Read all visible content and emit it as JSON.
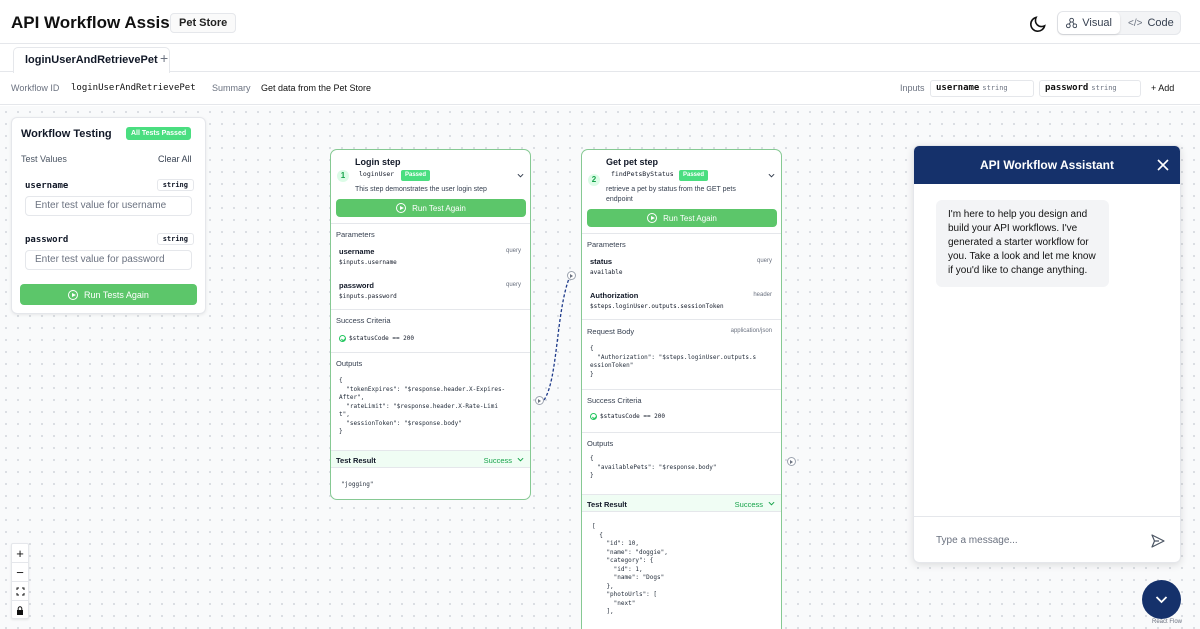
{
  "header": {
    "app_title": "API Workflow Assistant",
    "store_name": "Pet Store",
    "view_options": [
      "Visual",
      "Code"
    ],
    "active_view": "Visual"
  },
  "tabs": {
    "items": [
      "loginUserAndRetrievePet"
    ],
    "add_label": "+"
  },
  "meta": {
    "workflow_id_label": "Workflow ID",
    "workflow_id": "loginUserAndRetrievePet",
    "summary_label": "Summary",
    "summary": "Get data from the Pet Store",
    "inputs_label": "Inputs",
    "inputs": [
      {
        "name": "username",
        "type": "string"
      },
      {
        "name": "password",
        "type": "string"
      }
    ],
    "add_label": "+ Add"
  },
  "testing": {
    "title": "Workflow Testing",
    "status_badge": "All Tests Passed",
    "test_values_label": "Test Values",
    "clear_all_label": "Clear All",
    "fields": [
      {
        "name": "username",
        "type": "string",
        "placeholder": "Enter test value for username"
      },
      {
        "name": "password",
        "type": "string",
        "placeholder": "Enter test value for password"
      }
    ],
    "run_label": "Run Tests Again"
  },
  "step1": {
    "title": "Login step",
    "number": "1",
    "operation_id": "loginUser",
    "status": "Passed",
    "description": "This step demonstrates the user login step",
    "run_label": "Run Test Again",
    "parameters_label": "Parameters",
    "params": [
      {
        "name": "username",
        "in": "query",
        "value": "$inputs.username"
      },
      {
        "name": "password",
        "in": "query",
        "value": "$inputs.password"
      }
    ],
    "success_label": "Success Criteria",
    "criteria": "$statusCode == 200",
    "outputs_label": "Outputs",
    "outputs_code": "{\n  \"tokenExpires\": \"$response.header.X-Expires-\nAfter\",\n  \"rateLimit\": \"$response.header.X-Rate-Limi\nt\",\n  \"sessionToken\": \"$response.body\"\n}",
    "test_result_label": "Test Result",
    "test_result_status": "Success",
    "test_result": "\"jogging\""
  },
  "step2": {
    "title": "Get pet step",
    "number": "2",
    "operation_id": "findPetsByStatus",
    "status": "Passed",
    "description_line1": "retrieve a pet by status from the GET pets",
    "description_line2": "endpoint",
    "run_label": "Run Test Again",
    "parameters_label": "Parameters",
    "params": [
      {
        "name": "status",
        "in": "query",
        "value": "available"
      },
      {
        "name": "Authorization",
        "in": "header",
        "value": "$steps.loginUser.outputs.sessionToken"
      }
    ],
    "request_body_label": "Request Body",
    "request_body_type": "application/json",
    "request_body_code": "{\n  \"Authorization\": \"$steps.loginUser.outputs.s\nessionToken\"\n}",
    "success_label": "Success Criteria",
    "criteria": "$statusCode == 200",
    "outputs_label": "Outputs",
    "outputs_code": "{\n  \"availablePets\": \"$response.body\"\n}",
    "test_result_label": "Test Result",
    "test_result_status": "Success",
    "test_result": "[\n  {\n    \"id\": 10,\n    \"name\": \"doggie\",\n    \"category\": {\n      \"id\": 1,\n      \"name\": \"Dogs\"\n    },\n    \"photoUrls\": [\n      \"next\"\n    ],"
  },
  "chat": {
    "title": "API Workflow Assistant",
    "message": "I'm here to help you design and build your API workflows. I've generated a starter workflow for you. Take a look and let me know if you'd like to change anything.",
    "input_placeholder": "Type a message..."
  },
  "zoom": {
    "in": "+",
    "out": "−"
  },
  "footer": {
    "attribution": "React Flow"
  },
  "colors": {
    "accent": "#15316b",
    "success": "#5cc66a",
    "badge": "#4ade80"
  }
}
